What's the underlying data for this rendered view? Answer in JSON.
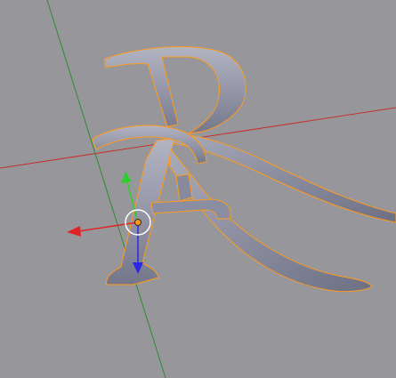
{
  "viewport": {
    "background": "#97979b",
    "selection_outline_color": "#ff9a1e",
    "object_fill_color": "#8f92a4",
    "object_highlight_color": "#b4b6c3",
    "object_shadow_color": "#5e6173"
  },
  "axes": {
    "x_axis_color": "#c4302f",
    "y_axis_color": "#2e8b2e"
  },
  "manipulator": {
    "x_arrow_color": "#e02424",
    "y_arrow_color": "#2ecc2e",
    "z_arrow_color": "#2828e6",
    "origin_color": "#ff9a1e",
    "ring_color": "#ffffff"
  },
  "objects": [
    {
      "name": "text-object-ra",
      "type": "extruded-text",
      "selected": true
    }
  ]
}
